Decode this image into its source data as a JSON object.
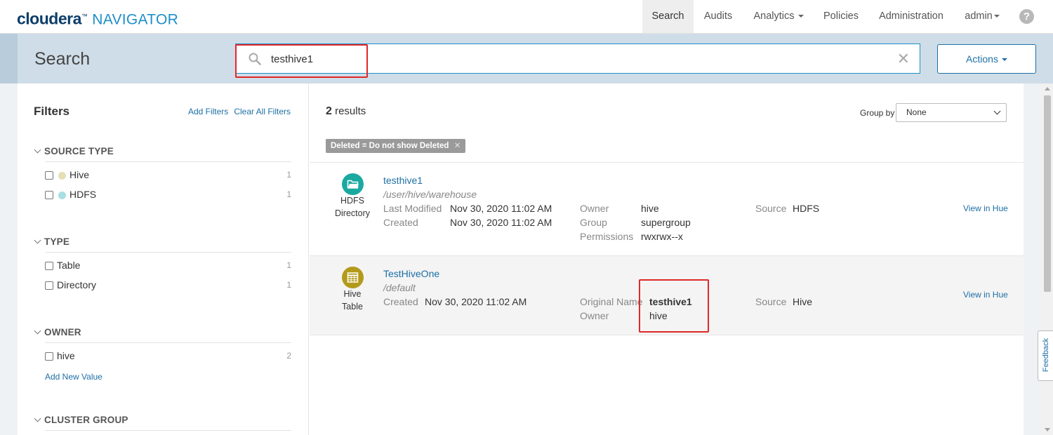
{
  "app": {
    "brand": "cloudera",
    "product": "NAVIGATOR",
    "tm": "™"
  },
  "nav": {
    "items": [
      {
        "label": "Search",
        "active": true
      },
      {
        "label": "Audits"
      },
      {
        "label": "Analytics"
      },
      {
        "label": "Policies"
      },
      {
        "label": "Administration"
      },
      {
        "label": "admin"
      }
    ],
    "help": "?"
  },
  "search": {
    "heading": "Search",
    "query": "testhive1",
    "clear": "✕",
    "actions_label": "Actions"
  },
  "filters": {
    "title": "Filters",
    "add_filters": "Add Filters",
    "clear_all": "Clear All Filters",
    "sections": [
      {
        "title": "SOURCE TYPE",
        "items": [
          {
            "label": "Hive",
            "count": "1",
            "color": "#e6dfb5"
          },
          {
            "label": "HDFS",
            "count": "1",
            "color": "#a8dfe2"
          }
        ]
      },
      {
        "title": "TYPE",
        "items": [
          {
            "label": "Table",
            "count": "1"
          },
          {
            "label": "Directory",
            "count": "1"
          }
        ]
      },
      {
        "title": "OWNER",
        "items": [
          {
            "label": "hive",
            "count": "2"
          }
        ],
        "add_value": "Add New Value"
      },
      {
        "title": "CLUSTER GROUP",
        "items": []
      }
    ]
  },
  "results": {
    "count": "2",
    "count_suffix": "results",
    "group_by_label": "Group by",
    "group_by_value": "None",
    "active_filter": "Deleted = Do not show Deleted",
    "active_filter_remove": "✕",
    "items": [
      {
        "type_label_1": "HDFS",
        "type_label_2": "Directory",
        "icon_color": "#1aa9a0",
        "name": "testhive1",
        "path": "/user/hive/warehouse",
        "last_modified_label": "Last Modified",
        "last_modified": "Nov 30, 2020 11:02 AM",
        "created_label": "Created",
        "created": "Nov 30, 2020 11:02 AM",
        "owner_label": "Owner",
        "owner": "hive",
        "group_label": "Group",
        "group": "supergroup",
        "permissions_label": "Permissions",
        "permissions": "rwxrwx--x",
        "source_label": "Source",
        "source": "HDFS",
        "view_link": "View in Hue"
      },
      {
        "type_label_1": "Hive",
        "type_label_2": "Table",
        "icon_color": "#b39a1a",
        "name": "TestHiveOne",
        "path": "/default",
        "created_label": "Created",
        "created": "Nov 30, 2020 11:02 AM",
        "original_name_label": "Original Name",
        "original_name": "testhive1",
        "owner_label": "Owner",
        "owner": "hive",
        "source_label": "Source",
        "source": "Hive",
        "view_link": "View in Hue"
      }
    ]
  },
  "feedback": "Feedback"
}
